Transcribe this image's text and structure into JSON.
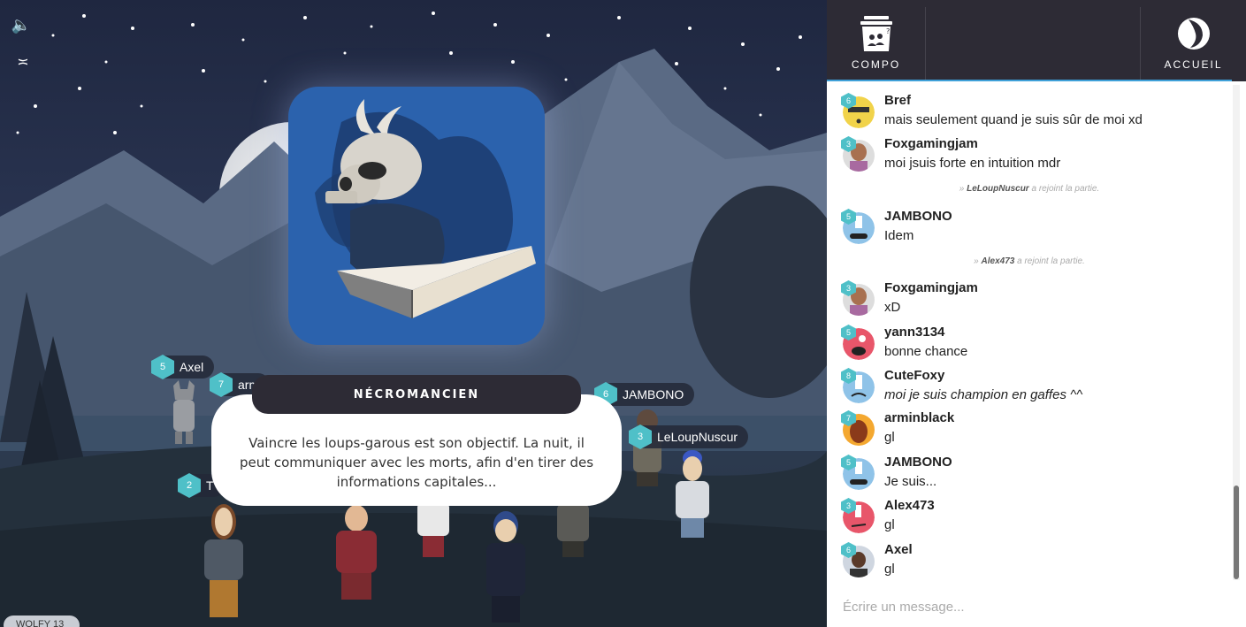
{
  "game": {
    "role_name": "NÉCROMANCIEN",
    "role_description": "Vaincre les loups-garous est son objectif. La nuit, il peut communiquer avec les morts, afin d'en tirer des informations capitales...",
    "game_label": "WOLFY 13",
    "players": [
      {
        "name": "Axel",
        "level": "5"
      },
      {
        "name": "arm",
        "level": "7"
      },
      {
        "name": "JAMBONO",
        "level": "6"
      },
      {
        "name": "LeLoupNuscur",
        "level": "3"
      },
      {
        "name": "T",
        "level": "2"
      }
    ]
  },
  "topbar": {
    "compo_label": "COMPO",
    "accueil_label": "ACCUEIL"
  },
  "chat": {
    "messages": [
      {
        "user": "Bref",
        "level": "6",
        "text": "mais seulement quand je suis sûr de moi xd"
      },
      {
        "user": "Foxgamingjam",
        "level": "3",
        "text": "moi jsuis forte en intuition mdr"
      },
      {
        "user": "JAMBONO",
        "level": "5",
        "text": "Idem"
      },
      {
        "user": "Foxgamingjam",
        "level": "3",
        "text": "xD"
      },
      {
        "user": "yann3134",
        "level": "5",
        "text": "bonne chance"
      },
      {
        "user": "CuteFoxy",
        "level": "8",
        "text": "moi je suis champion en gaffes ^^"
      },
      {
        "user": "arminblack",
        "level": "7",
        "text": "gl"
      },
      {
        "user": "JAMBONO",
        "level": "5",
        "text": "Je suis..."
      },
      {
        "user": "Alex473",
        "level": "3",
        "text": "gl"
      },
      {
        "user": "Axel",
        "level": "6",
        "text": "gl"
      }
    ],
    "system": [
      {
        "user": "LeLoupNuscur",
        "text": "a rejoint la partie."
      },
      {
        "user": "Alex473",
        "text": "a rejoint la partie."
      }
    ],
    "input_placeholder": "Écrire un message..."
  },
  "colors": {
    "topbar": "#2d2b35",
    "level_hex": "#4fc0c8",
    "card_blue": "#2b62ad",
    "accent_line": "#3ea0d8"
  }
}
